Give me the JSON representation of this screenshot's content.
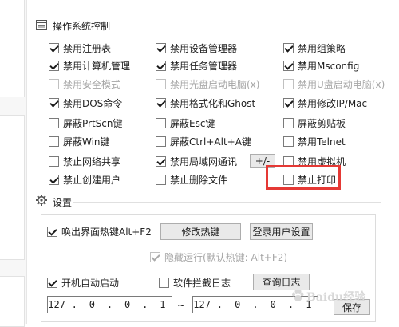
{
  "os_control": {
    "title": "操作系统控制",
    "col1": [
      {
        "label": "禁用注册表",
        "checked": true,
        "disabled": false
      },
      {
        "label": "禁用计算机管理",
        "checked": true,
        "disabled": false
      },
      {
        "label": "禁用安全模式",
        "checked": false,
        "disabled": true
      },
      {
        "label": "禁用DOS命令",
        "checked": true,
        "disabled": false
      },
      {
        "label": "屏蔽PrtScn键",
        "checked": false,
        "disabled": false
      },
      {
        "label": "屏蔽Win键",
        "checked": false,
        "disabled": false
      },
      {
        "label": "禁止网络共享",
        "checked": false,
        "disabled": false
      },
      {
        "label": "禁止创建用户",
        "checked": true,
        "disabled": false
      }
    ],
    "col2": [
      {
        "label": "禁用设备管理器",
        "checked": true,
        "disabled": false
      },
      {
        "label": "禁用任务管理器",
        "checked": true,
        "disabled": false
      },
      {
        "label": "禁用光盘启动电脑(x)",
        "checked": false,
        "disabled": true
      },
      {
        "label": "禁用格式化和Ghost",
        "checked": true,
        "disabled": false
      },
      {
        "label": "屏蔽Esc键",
        "checked": false,
        "disabled": false
      },
      {
        "label": "屏蔽Ctrl+Alt+A键",
        "checked": false,
        "disabled": false
      },
      {
        "label": "禁用局域网通讯",
        "checked": true,
        "disabled": false
      },
      {
        "label": "禁止删除文件",
        "checked": false,
        "disabled": false
      }
    ],
    "col3": [
      {
        "label": "禁用组策略",
        "checked": true,
        "disabled": false
      },
      {
        "label": "禁用Msconfig",
        "checked": true,
        "disabled": false
      },
      {
        "label": "禁用U盘启动电脑(x)",
        "checked": false,
        "disabled": true
      },
      {
        "label": "禁用修改IP/Mac",
        "checked": true,
        "disabled": false
      },
      {
        "label": "屏蔽剪贴板",
        "checked": false,
        "disabled": false
      },
      {
        "label": "禁用Telnet",
        "checked": false,
        "disabled": false
      },
      {
        "label": "禁用虚拟机",
        "checked": false,
        "disabled": false
      },
      {
        "label": "禁止打印",
        "checked": false,
        "disabled": false
      }
    ],
    "plus_minus_label": "+/-"
  },
  "settings": {
    "title": "设置",
    "hotkey_label": "唤出界面热键Alt+F2",
    "hotkey_checked": true,
    "modify_hotkey_button": "修改热键",
    "login_settings_button": "登录用户设置",
    "hidden_run_label": "隐藏运行(默认热键: Alt+F2)",
    "hidden_run_checked": true,
    "autostart_label": "开机自动启动",
    "autostart_checked": true,
    "intercept_log_label": "软件拦截日志",
    "intercept_log_checked": false,
    "query_log_button": "查询日志",
    "ip_from": [
      "127",
      "0",
      "0",
      "1"
    ],
    "ip_to": [
      "127",
      "0",
      "0",
      "1"
    ],
    "ip_range_separator": "~",
    "save_button": "保存"
  },
  "colors": {
    "highlight": "#e53935"
  },
  "watermark": "Baidu经验"
}
